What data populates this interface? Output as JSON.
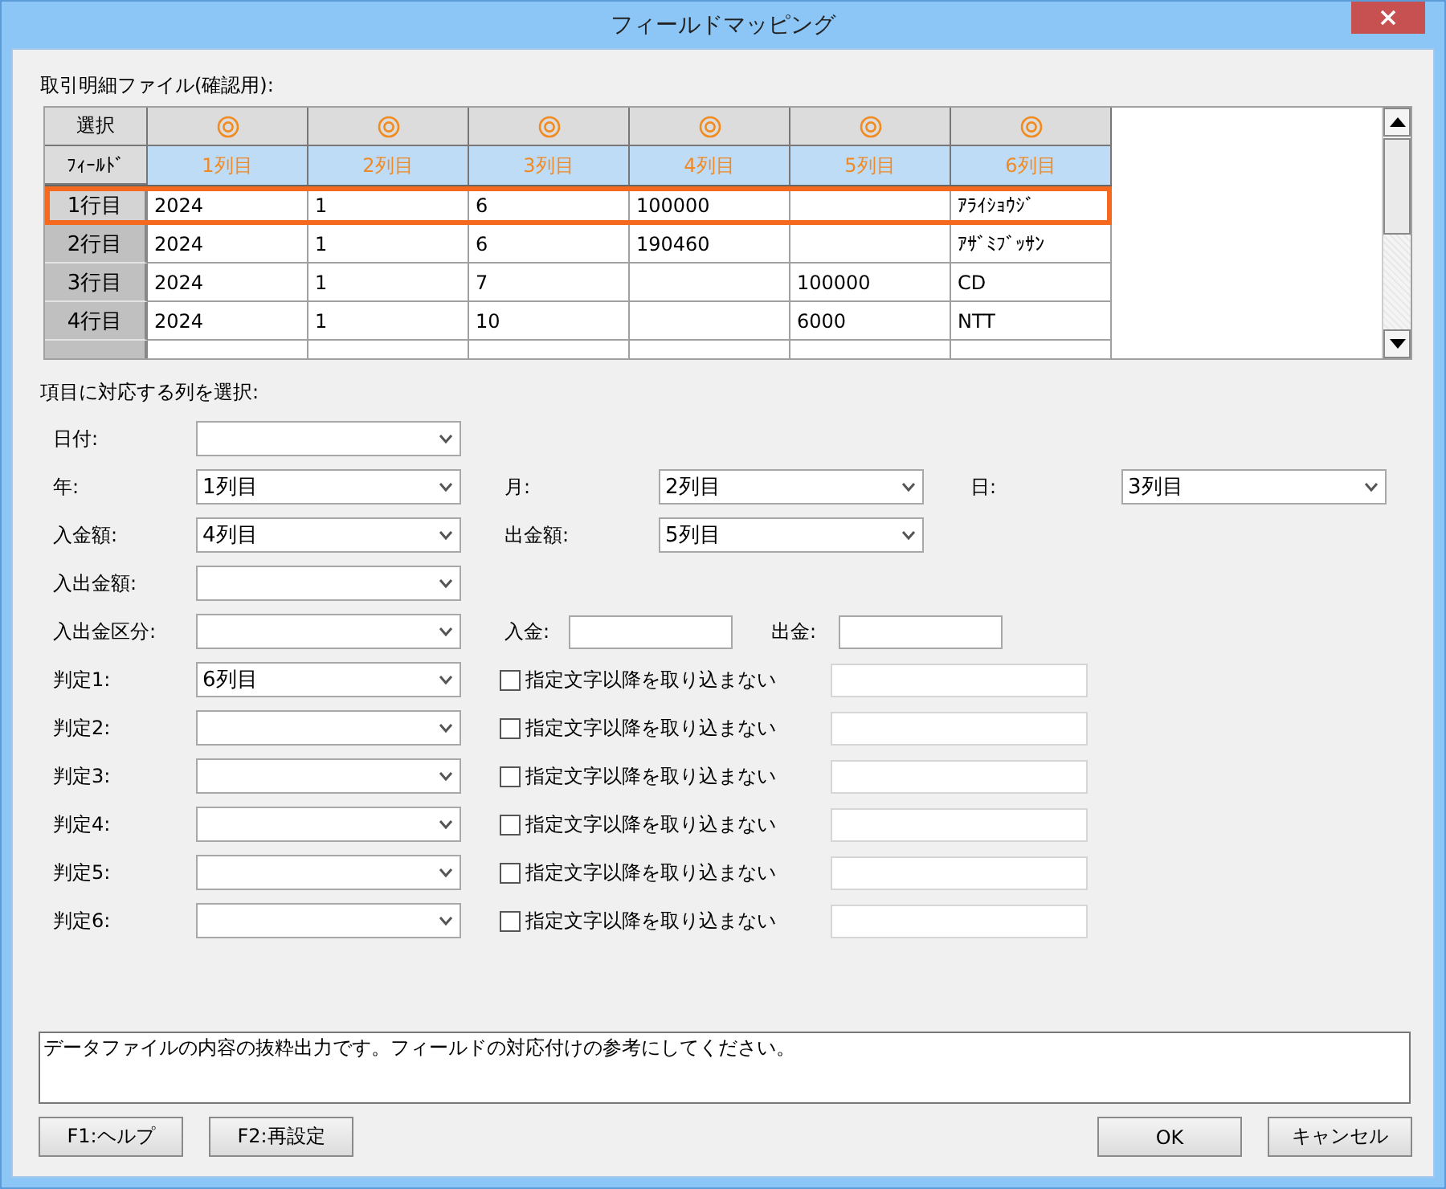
{
  "window": {
    "title": "フィールドマッピング"
  },
  "preview": {
    "label": "取引明細ファイル(確認用):",
    "corner_labels": [
      "選択",
      "ﾌｨｰﾙﾄﾞ"
    ],
    "columns": [
      {
        "name": "1列目"
      },
      {
        "name": "2列目"
      },
      {
        "name": "3列目"
      },
      {
        "name": "4列目"
      },
      {
        "name": "5列目"
      },
      {
        "name": "6列目"
      }
    ],
    "rows": [
      {
        "header": "1行目",
        "selected": true,
        "cells": [
          "2024",
          "1",
          "6",
          "100000",
          null,
          "ｱﾗｲｼｮｳｼﾞ"
        ]
      },
      {
        "header": "2行目",
        "selected": false,
        "cells": [
          "2024",
          "1",
          "6",
          "190460",
          null,
          "ｱｻﾞﾐﾌﾞｯｻﾝ"
        ]
      },
      {
        "header": "3行目",
        "selected": false,
        "cells": [
          "2024",
          "1",
          "7",
          null,
          "100000",
          "CD"
        ]
      },
      {
        "header": "4行目",
        "selected": false,
        "cells": [
          "2024",
          "1",
          "10",
          null,
          "6000",
          "NTT"
        ]
      }
    ]
  },
  "mapping": {
    "label": "項目に対応する列を選択:",
    "rows": [
      [
        {
          "kind": "select",
          "label": "日付:"
        }
      ],
      [
        {
          "kind": "select",
          "label": "年:",
          "value": "1列目"
        },
        {
          "kind": "select",
          "label": "月:",
          "value": "2列目"
        },
        {
          "kind": "select",
          "label": "日:",
          "value": "3列目"
        }
      ],
      [
        {
          "kind": "select",
          "label": "入金額:",
          "value": "4列目"
        },
        {
          "kind": "select",
          "label": "出金額:",
          "value": "5列目"
        }
      ],
      [
        {
          "kind": "select",
          "label": "入出金額:"
        }
      ],
      [
        {
          "kind": "select",
          "label": "入出金区分:"
        },
        {
          "kind": "text",
          "label": "入金:"
        },
        {
          "kind": "text",
          "label": "出金:"
        }
      ],
      [
        {
          "kind": "select",
          "label": "判定1:",
          "value": "6列目"
        },
        {
          "kind": "exclude",
          "label": "指定文字以降を取り込まない",
          "checked": false
        }
      ],
      [
        {
          "kind": "select",
          "label": "判定2:"
        },
        {
          "kind": "exclude",
          "label": "指定文字以降を取り込まない",
          "checked": false
        }
      ],
      [
        {
          "kind": "select",
          "label": "判定3:"
        },
        {
          "kind": "exclude",
          "label": "指定文字以降を取り込まない",
          "checked": false
        }
      ],
      [
        {
          "kind": "select",
          "label": "判定4:"
        },
        {
          "kind": "exclude",
          "label": "指定文字以降を取り込まない",
          "checked": false
        }
      ],
      [
        {
          "kind": "select",
          "label": "判定5:"
        },
        {
          "kind": "exclude",
          "label": "指定文字以降を取り込まない",
          "checked": false
        }
      ],
      [
        {
          "kind": "select",
          "label": "判定6:"
        },
        {
          "kind": "exclude",
          "label": "指定文字以降を取り込まない",
          "checked": false
        }
      ]
    ]
  },
  "note": "データファイルの内容の抜粋出力です。フィールドの対応付けの参考にしてください。",
  "buttons_left": [
    "F1:ヘルプ",
    "F2:再設定"
  ],
  "buttons_right": [
    "OK",
    "キャンセル"
  ]
}
